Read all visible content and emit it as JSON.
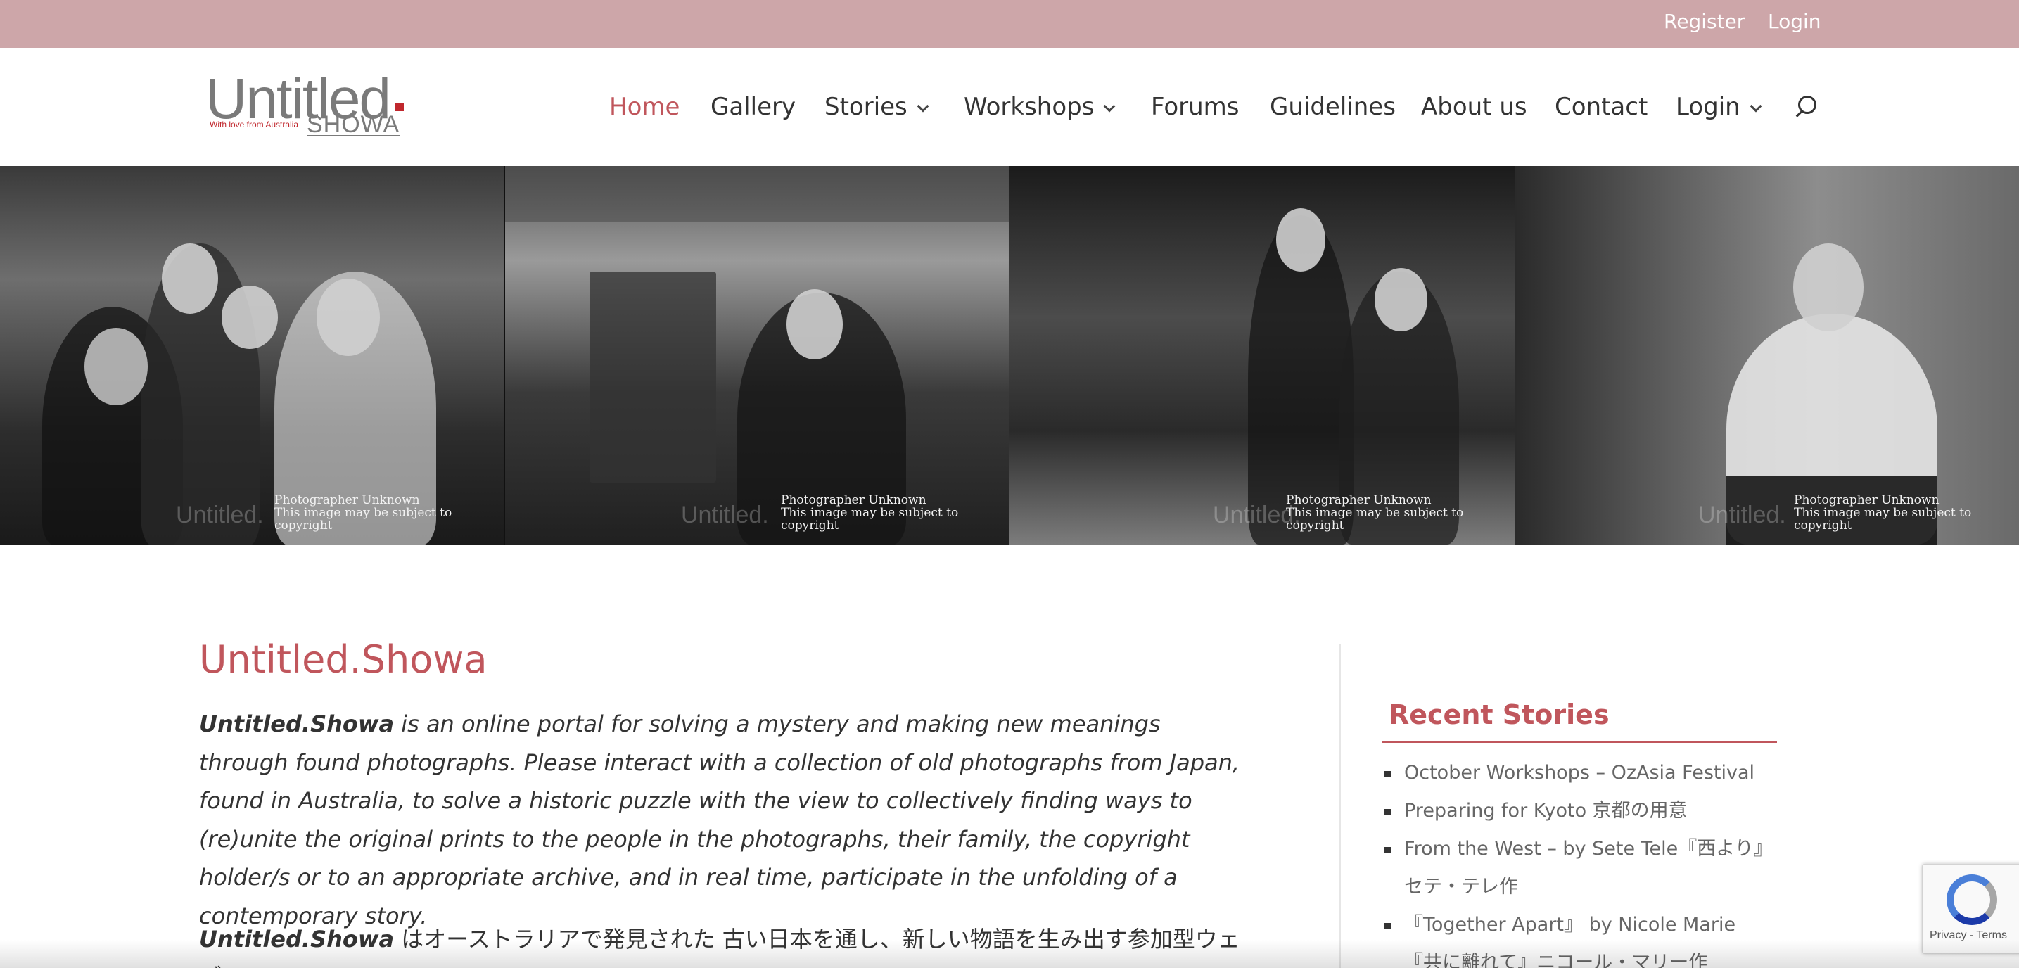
{
  "topbar": {
    "register": "Register",
    "login": "Login"
  },
  "logo": {
    "main": "Untitled",
    "tagline": "With love from Australia",
    "sub": "SHOWA"
  },
  "nav": {
    "items": [
      {
        "label": "Home"
      },
      {
        "label": "Gallery"
      },
      {
        "label": "Stories"
      },
      {
        "label": "Workshops"
      },
      {
        "label": "Forums"
      },
      {
        "label": "Guidelines"
      },
      {
        "label": "About us"
      },
      {
        "label": "Contact"
      },
      {
        "label": "Login"
      }
    ],
    "active": "Home"
  },
  "banner": {
    "photos": [
      {
        "credit_line1": "Photographer Unknown",
        "credit_line2": "This image may be subject to copyright",
        "watermark": "Untitled."
      },
      {
        "credit_line1": "Photographer Unknown",
        "credit_line2": "This image may be subject to copyright",
        "watermark": "Untitled."
      },
      {
        "credit_line1": "Photographer Unknown",
        "credit_line2": "This image may be subject to copyright",
        "watermark": "Untitled."
      },
      {
        "credit_line1": "Photographer Unknown",
        "credit_line2": "This image may be subject to copyright",
        "watermark": "Untitled."
      }
    ]
  },
  "main": {
    "title": "Untitled.Showa",
    "intro_brand": "Untitled.Showa",
    "intro_text": " is an online portal for solving a mystery and making new meanings through found photographs. Please interact with a collection of old photographs from Japan, found in Australia, to solve a historic puzzle with the view to collectively finding ways to (re)unite the original prints to the people in the photographs, their family, the copyright holder/s or to an appropriate archive, and in real time, participate in the unfolding of a contemporary story.",
    "jp_brand": "Untitled.Showa",
    "jp_text": " はオーストラリアで発見された 古い日本を通し、新しい物語を生み出す参加型ウェブ"
  },
  "sidebar": {
    "title": "Recent Stories",
    "stories": [
      "October Workshops – OzAsia Festival",
      "Preparing for Kyoto 京都の用意",
      "From the West – by Sete Tele『西より』セテ・テレ作",
      "『Together Apart』 by Nicole Marie 『共に離れて』ニコール・マリー作"
    ]
  },
  "recaptcha": {
    "text": "Privacy - Terms"
  },
  "colors": {
    "accent": "#c0565c",
    "topbar": "#cda6a9"
  }
}
